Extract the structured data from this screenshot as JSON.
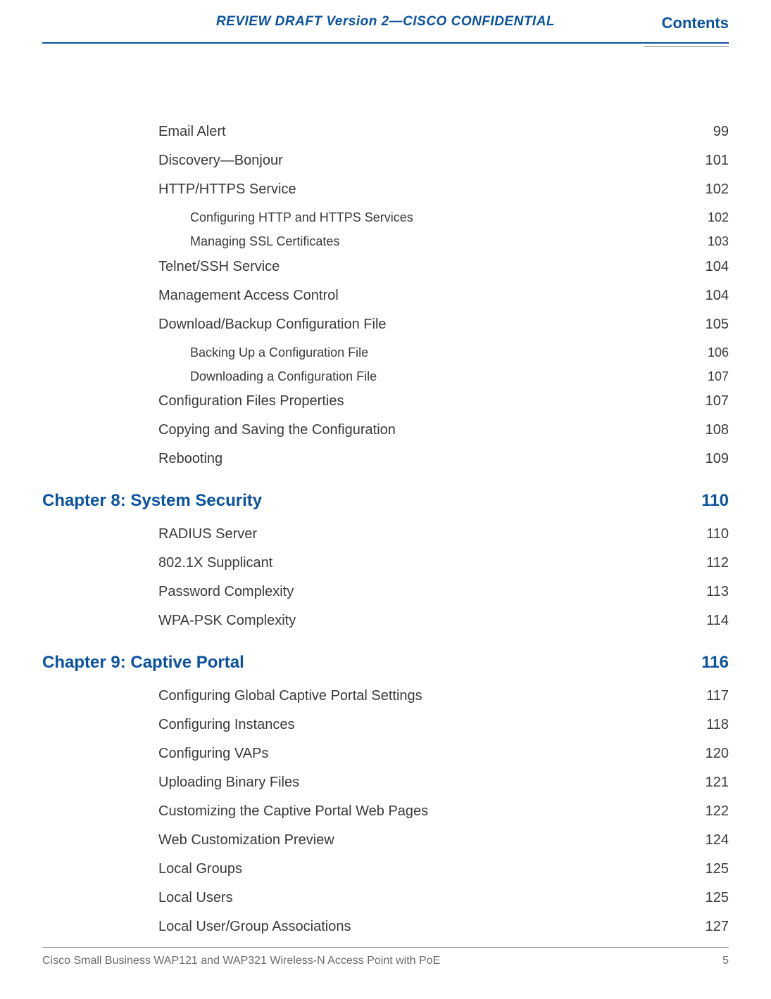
{
  "header": {
    "draft": "REVIEW DRAFT  Version 2—CISCO CONFIDENTIAL",
    "contents": "Contents"
  },
  "toc": [
    {
      "type": "level1",
      "title": "Email Alert",
      "page": "99"
    },
    {
      "type": "level1",
      "title": "Discovery—Bonjour",
      "page": "101"
    },
    {
      "type": "level1",
      "title": "HTTP/HTTPS Service",
      "page": "102"
    },
    {
      "type": "level2",
      "title": "Configuring HTTP and HTTPS Services",
      "page": "102"
    },
    {
      "type": "level2",
      "title": "Managing SSL Certificates",
      "page": "103"
    },
    {
      "type": "level1",
      "title": "Telnet/SSH Service",
      "page": "104"
    },
    {
      "type": "level1",
      "title": "Management Access Control",
      "page": "104"
    },
    {
      "type": "level1",
      "title": "Download/Backup Configuration File",
      "page": "105"
    },
    {
      "type": "level2",
      "title": "Backing Up a Configuration File",
      "page": "106"
    },
    {
      "type": "level2",
      "title": "Downloading a Configuration File",
      "page": "107"
    },
    {
      "type": "level1",
      "title": "Configuration Files Properties",
      "page": "107"
    },
    {
      "type": "level1",
      "title": "Copying and Saving the Configuration",
      "page": "108"
    },
    {
      "type": "level1",
      "title": "Rebooting",
      "page": "109"
    },
    {
      "type": "chapter",
      "title": "Chapter 8: System Security",
      "page": "110"
    },
    {
      "type": "level1",
      "title": "RADIUS Server",
      "page": "110"
    },
    {
      "type": "level1",
      "title": "802.1X Supplicant",
      "page": "112"
    },
    {
      "type": "level1",
      "title": "Password Complexity",
      "page": "113"
    },
    {
      "type": "level1",
      "title": "WPA-PSK Complexity",
      "page": "114"
    },
    {
      "type": "chapter",
      "title": "Chapter 9: Captive Portal",
      "page": "116"
    },
    {
      "type": "level1",
      "title": "Configuring Global Captive Portal Settings",
      "page": "117"
    },
    {
      "type": "level1",
      "title": "Configuring Instances",
      "page": "118"
    },
    {
      "type": "level1",
      "title": "Configuring VAPs",
      "page": "120"
    },
    {
      "type": "level1",
      "title": "Uploading Binary Files",
      "page": "121"
    },
    {
      "type": "level1",
      "title": "Customizing the Captive Portal Web Pages",
      "page": "122"
    },
    {
      "type": "level1",
      "title": "Web Customization Preview",
      "page": "124"
    },
    {
      "type": "level1",
      "title": "Local Groups",
      "page": "125"
    },
    {
      "type": "level1",
      "title": "Local Users",
      "page": "125"
    },
    {
      "type": "level1",
      "title": "Local User/Group Associations",
      "page": "127"
    }
  ],
  "footer": {
    "title": "Cisco Small Business WAP121 and WAP321 Wireless-N Access Point with PoE",
    "page": "5"
  }
}
